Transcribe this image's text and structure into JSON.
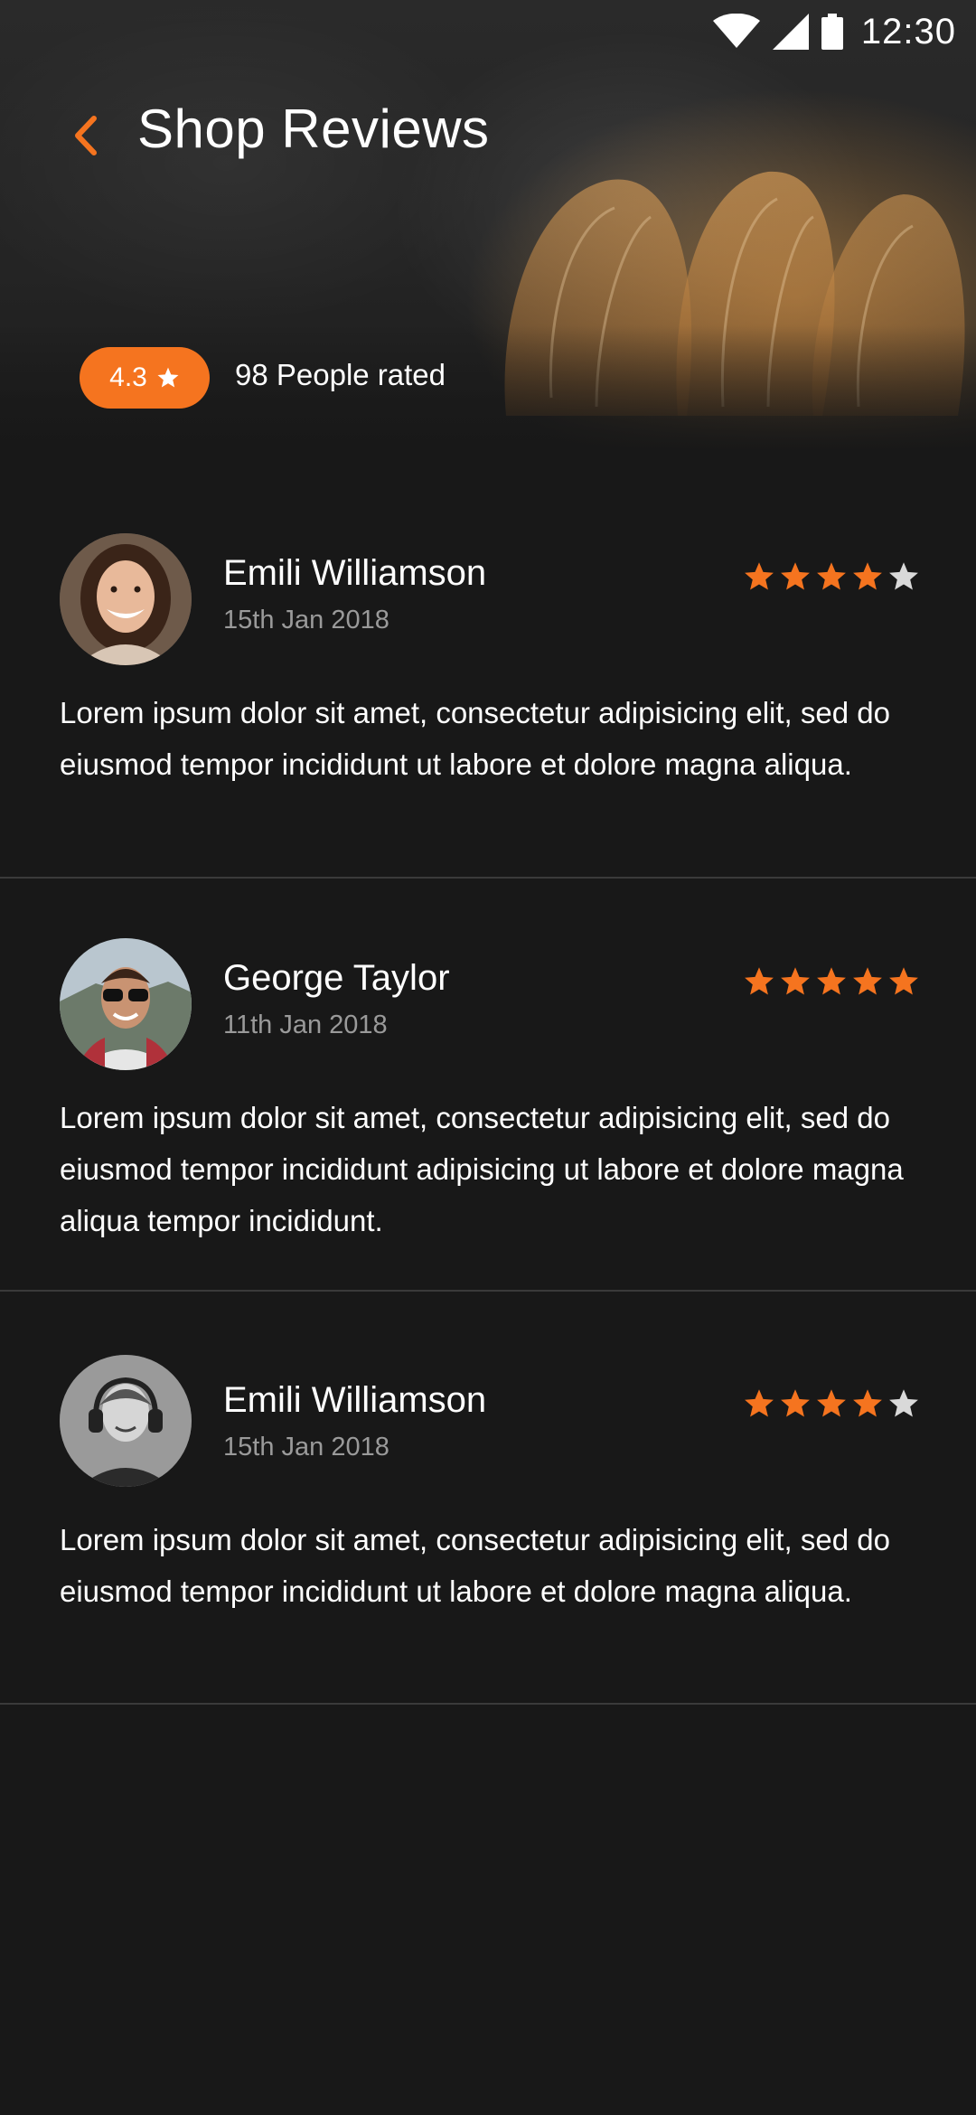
{
  "status_bar": {
    "time": "12:30"
  },
  "header": {
    "title": "Shop Reviews"
  },
  "summary": {
    "rating": "4.3",
    "people_rated": "98 People rated"
  },
  "colors": {
    "accent": "#f5741f",
    "background": "#181818",
    "star_empty": "#d9d9d9"
  },
  "reviews": [
    {
      "name": "Emili Williamson",
      "date": "15th Jan 2018",
      "rating": 4,
      "text": "Lorem ipsum dolor sit amet, consectetur adipisicing elit, sed do eiusmod tempor incididunt ut labore et dolore magna aliqua."
    },
    {
      "name": "George Taylor",
      "date": "11th Jan 2018",
      "rating": 5,
      "text": "Lorem ipsum dolor sit amet, consectetur adipisicing elit, sed do eiusmod tempor incididunt adipisicing  ut labore et dolore magna aliqua tempor incididunt."
    },
    {
      "name": "Emili Williamson",
      "date": "15th Jan 2018",
      "rating": 4,
      "text": "Lorem ipsum dolor sit amet, consectetur adipisicing elit, sed do eiusmod tempor incididunt ut labore et dolore magna aliqua."
    }
  ]
}
